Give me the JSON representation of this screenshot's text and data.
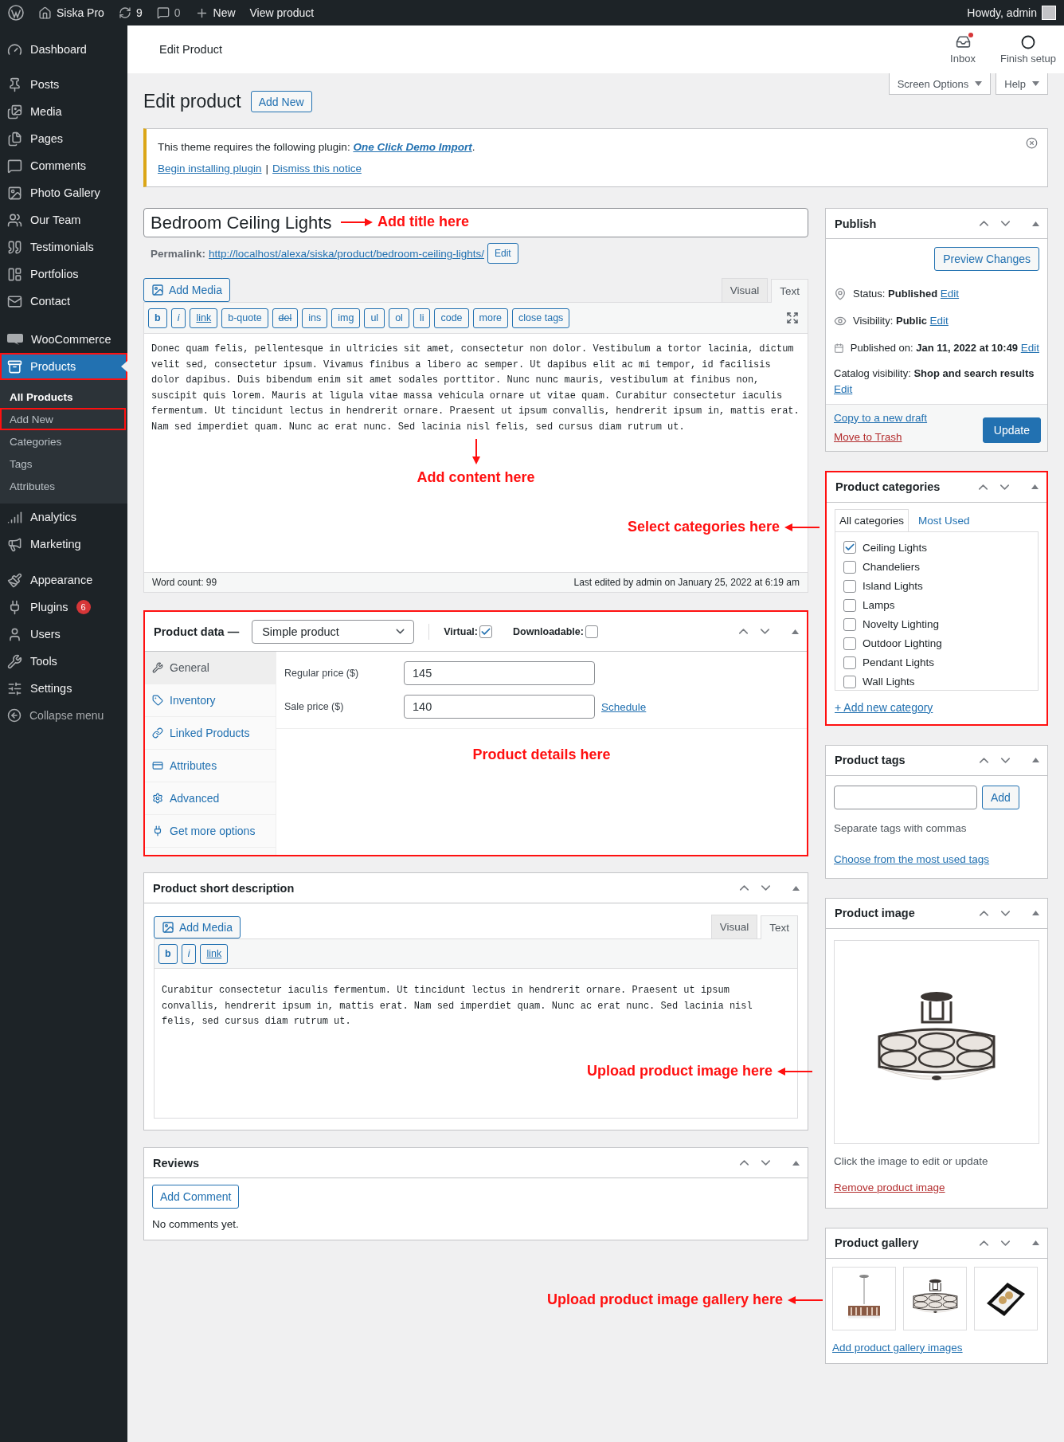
{
  "admin_bar": {
    "site": "Siska Pro",
    "updates": "9",
    "comments": "0",
    "new": "New",
    "view": "View product",
    "greeting": "Howdy, admin"
  },
  "header": {
    "title": "Edit Product",
    "actions": [
      {
        "label": "Inbox",
        "kind": "inbox",
        "badge": true
      },
      {
        "label": "Finish setup",
        "kind": "setup",
        "badge": false
      }
    ]
  },
  "sidebar": {
    "groups": [
      [
        {
          "label": "Dashboard",
          "selected": false,
          "highlighted": false
        }
      ],
      [
        {
          "label": "Posts",
          "selected": false,
          "highlighted": false
        },
        {
          "label": "Media",
          "selected": false,
          "highlighted": false
        },
        {
          "label": "Pages",
          "selected": false,
          "highlighted": false
        },
        {
          "label": "Comments",
          "selected": false,
          "highlighted": false
        },
        {
          "label": "Photo Gallery",
          "selected": false,
          "highlighted": false
        },
        {
          "label": "Our Team",
          "selected": false,
          "highlighted": false
        },
        {
          "label": "Testimonials",
          "selected": false,
          "highlighted": false
        },
        {
          "label": "Portfolios",
          "selected": false,
          "highlighted": false
        },
        {
          "label": "Contact",
          "selected": false,
          "highlighted": false
        }
      ],
      [
        {
          "label": "WooCommerce",
          "selected": false,
          "highlighted": false
        },
        {
          "label": "Products",
          "selected": true,
          "highlighted": true,
          "submenu": [
            {
              "label": "All Products",
              "selected": true,
              "highlighted": false
            },
            {
              "label": "Add New",
              "selected": false,
              "highlighted": true
            },
            {
              "label": "Categories",
              "selected": false,
              "highlighted": false
            },
            {
              "label": "Tags",
              "selected": false,
              "highlighted": false
            },
            {
              "label": "Attributes",
              "selected": false,
              "highlighted": false
            }
          ]
        },
        {
          "label": "Analytics",
          "selected": false,
          "highlighted": false
        },
        {
          "label": "Marketing",
          "selected": false,
          "highlighted": false
        }
      ],
      [
        {
          "label": "Appearance",
          "selected": false,
          "highlighted": false
        },
        {
          "label": "Plugins",
          "selected": false,
          "highlighted": false,
          "badge": "6"
        },
        {
          "label": "Users",
          "selected": false,
          "highlighted": false
        },
        {
          "label": "Tools",
          "selected": false,
          "highlighted": false
        },
        {
          "label": "Settings",
          "selected": false,
          "highlighted": false
        }
      ]
    ],
    "collapse": "Collapse menu"
  },
  "screen_meta": [
    "Screen Options",
    "Help"
  ],
  "page": {
    "title": "Edit product",
    "add_new": "Add New"
  },
  "notice": {
    "message": "This theme requires the following plugin:",
    "plugin": "One Click Demo Import",
    "end": ".",
    "links": [
      "Begin installing plugin",
      "Dismiss this notice"
    ],
    "separator": "|"
  },
  "post": {
    "title": "Bedroom Ceiling Lights",
    "title_note": "Add title here",
    "permalink_label": "Permalink:",
    "permalink": "http://localhost/alexa/siska/product/bedroom-ceiling-lights/",
    "permalink_edit": "Edit"
  },
  "editor": {
    "add_media": "Add Media",
    "tabs": [
      {
        "label": "Visual",
        "selected": false
      },
      {
        "label": "Text",
        "selected": true
      }
    ],
    "buttons": [
      {
        "label": "b",
        "kind": "bold"
      },
      {
        "label": "i",
        "kind": "italic"
      },
      {
        "label": "link",
        "kind": "link"
      },
      {
        "label": "b-quote",
        "kind": "plain"
      },
      {
        "label": "del",
        "kind": "strike"
      },
      {
        "label": "ins",
        "kind": "plain"
      },
      {
        "label": "img",
        "kind": "plain"
      },
      {
        "label": "ul",
        "kind": "plain"
      },
      {
        "label": "ol",
        "kind": "plain"
      },
      {
        "label": "li",
        "kind": "plain"
      },
      {
        "label": "code",
        "kind": "plain"
      },
      {
        "label": "more",
        "kind": "plain"
      },
      {
        "label": "close tags",
        "kind": "plain"
      }
    ],
    "content": "Donec quam felis, pellentesque in ultricies sit amet, consectetur non dolor. Vestibulum a tortor lacinia, dictum velit sed, consectetur ipsum. Vivamus finibus a libero ac semper. Ut dapibus elit ac mi tempor, id facilisis dolor dapibus. Duis bibendum enim sit amet sodales porttitor. Nunc nunc mauris, vestibulum at finibus non, suscipit quis lorem. Mauris at ligula vitae massa vehicula ornare ut vitae quam. Curabitur consectetur iaculis fermentum. Ut tincidunt lectus in hendrerit ornare. Praesent ut ipsum convallis, hendrerit ipsum in, mattis erat. Nam sed imperdiet quam. Nunc ac erat nunc. Sed lacinia nisl felis, sed cursus diam rutrum ut.",
    "notes": [
      {
        "text": "Add content here",
        "kind": "down"
      },
      {
        "text": "Select categories here",
        "kind": "right"
      }
    ],
    "word_count": "Word count: 99",
    "last_edited": "Last edited by admin on January 25, 2022 at 6:19 am"
  },
  "product_data": {
    "highlighted": true,
    "title": "Product data —",
    "type": "Simple product",
    "options": [
      {
        "label": "Virtual:",
        "checked": true
      },
      {
        "label": "Downloadable:",
        "checked": false
      }
    ],
    "tabs": [
      {
        "label": "General",
        "selected": true
      },
      {
        "label": "Inventory",
        "selected": false
      },
      {
        "label": "Linked Products",
        "selected": false
      },
      {
        "label": "Attributes",
        "selected": false
      },
      {
        "label": "Advanced",
        "selected": false
      },
      {
        "label": "Get more options",
        "selected": false
      }
    ],
    "fields": [
      {
        "label": "Regular price ($)",
        "value": "145"
      },
      {
        "label": "Sale price ($)",
        "value": "140",
        "link": "Schedule"
      }
    ],
    "note": "Product details here"
  },
  "short_description": {
    "title": "Product short description",
    "add_media": "Add Media",
    "tabs": [
      {
        "label": "Visual",
        "selected": false
      },
      {
        "label": "Text",
        "selected": true
      }
    ],
    "buttons": [
      {
        "label": "b",
        "kind": "bold"
      },
      {
        "label": "i",
        "kind": "italic"
      },
      {
        "label": "link",
        "kind": "link"
      }
    ],
    "content": "Curabitur consectetur iaculis fermentum. Ut tincidunt lectus in hendrerit ornare. Praesent ut ipsum convallis, hendrerit ipsum in, mattis erat. Nam sed imperdiet quam. Nunc ac erat nunc. Sed lacinia nisl felis, sed cursus diam rutrum ut.",
    "note": "Upload product image here"
  },
  "reviews": {
    "title": "Reviews",
    "button": "Add Comment",
    "empty": "No comments yet."
  },
  "gallery_note": "Upload product image gallery here",
  "publish": {
    "title": "Publish",
    "preview": "Preview Changes",
    "rows": [
      {
        "label": "Status:",
        "value": "Published",
        "link": "Edit"
      },
      {
        "label": "Visibility:",
        "value": "Public",
        "link": "Edit"
      },
      {
        "label": "Published on:",
        "value": "Jan 11, 2022 at 10:49",
        "link": "Edit"
      }
    ],
    "catalog": {
      "label": "Catalog visibility:",
      "value": "Shop and search results",
      "link": "Edit"
    },
    "copy": "Copy to a new draft",
    "trash": "Move to Trash",
    "update": "Update"
  },
  "categories": {
    "highlighted": true,
    "title": "Product categories",
    "tabs": [
      {
        "label": "All categories",
        "selected": true
      },
      {
        "label": "Most Used",
        "selected": false
      }
    ],
    "items": [
      {
        "label": "Ceiling Lights",
        "checked": true
      },
      {
        "label": "Chandeliers",
        "checked": false
      },
      {
        "label": "Island Lights",
        "checked": false
      },
      {
        "label": "Lamps",
        "checked": false
      },
      {
        "label": "Novelty Lighting",
        "checked": false
      },
      {
        "label": "Outdoor Lighting",
        "checked": false
      },
      {
        "label": "Pendant Lights",
        "checked": false
      },
      {
        "label": "Wall Lights",
        "checked": false
      }
    ],
    "add_link": "+ Add new category"
  },
  "tags": {
    "highlighted": false,
    "title": "Product tags",
    "button": "Add",
    "hint": "Separate tags with commas",
    "link": "Choose from the most used tags"
  },
  "product_image": {
    "highlighted": false,
    "title": "Product image",
    "hint": "Click the image to edit or update",
    "remove": "Remove product image"
  },
  "gallery": {
    "highlighted": false,
    "title": "Product gallery",
    "images": [
      {
        "kind": "pendant"
      },
      {
        "kind": "drum"
      },
      {
        "kind": "spot"
      }
    ],
    "link": "Add product gallery images"
  }
}
